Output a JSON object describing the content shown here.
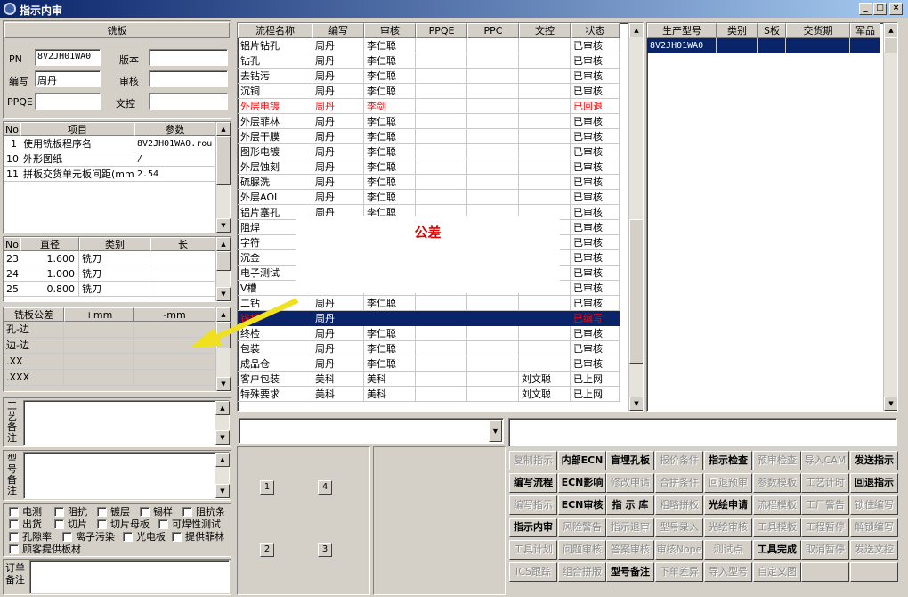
{
  "window": {
    "title": "指示内审"
  },
  "left": {
    "section_title": "铣板",
    "pn_label": "PN",
    "pn_value": "8V2JH01WA0",
    "version_label": "版本",
    "version_value": "",
    "writer_label": "编写",
    "writer_value": "周丹",
    "review_label": "审核",
    "review_value": "",
    "ppqe_label": "PPQE",
    "ppqe_value": "",
    "dc_label": "文控",
    "dc_value": "",
    "params": {
      "headers": [
        "No",
        "项目",
        "参数"
      ],
      "rows": [
        [
          "1",
          "使用铣板程序名",
          "8V2JH01WA0.rou"
        ],
        [
          "10",
          "外形图纸",
          "/"
        ],
        [
          "11",
          "拼板交货单元板间距(mm",
          "2.54"
        ]
      ]
    },
    "tools": {
      "headers": [
        "No",
        "直径",
        "类别",
        "长"
      ],
      "rows": [
        [
          "23",
          "1.600",
          "铣刀",
          ""
        ],
        [
          "24",
          "1.000",
          "铣刀",
          ""
        ],
        [
          "25",
          "0.800",
          "铣刀",
          ""
        ]
      ]
    },
    "tolerance": {
      "headers": [
        "铣板公差",
        "+mm",
        "-mm"
      ],
      "rows": [
        [
          "孔-边",
          "",
          ""
        ],
        [
          "边-边",
          "",
          ""
        ],
        [
          ".XX",
          "",
          ""
        ],
        [
          ".XXX",
          "",
          ""
        ]
      ]
    },
    "process_note_label": "工艺备注",
    "model_note_label": "型号备注",
    "order_note_label": "订单备注",
    "checkboxes": [
      {
        "label": "电测",
        "checked": false
      },
      {
        "label": "阻抗",
        "checked": false
      },
      {
        "label": "镀层",
        "checked": false
      },
      {
        "label": "锡样",
        "checked": false
      },
      {
        "label": "阻抗条",
        "checked": false
      },
      {
        "label": "出货",
        "checked": false
      },
      {
        "label": "切片",
        "checked": false
      },
      {
        "label": "切片母板",
        "checked": false
      },
      {
        "label": "可焊性测试",
        "checked": false
      },
      {
        "label": "孔隙率",
        "checked": false
      },
      {
        "label": "离子污染",
        "checked": false
      },
      {
        "label": "光电板",
        "checked": false
      },
      {
        "label": "提供菲林",
        "checked": false
      },
      {
        "label": "顾客提供板材",
        "checked": false
      }
    ]
  },
  "flow": {
    "headers": [
      "流程名称",
      "编写",
      "审核",
      "PPQE",
      "PPC",
      "文控",
      "状态"
    ],
    "rows": [
      {
        "c": [
          "铝片钻孔",
          "周丹",
          "李仁聪",
          "",
          "",
          "",
          "已审核"
        ],
        "s": "n"
      },
      {
        "c": [
          "钻孔",
          "周丹",
          "李仁聪",
          "",
          "",
          "",
          "已审核"
        ],
        "s": "n"
      },
      {
        "c": [
          "去钻污",
          "周丹",
          "李仁聪",
          "",
          "",
          "",
          "已审核"
        ],
        "s": "n"
      },
      {
        "c": [
          "沉铜",
          "周丹",
          "李仁聪",
          "",
          "",
          "",
          "已审核"
        ],
        "s": "n"
      },
      {
        "c": [
          "外层电镀",
          "周丹",
          "李剑",
          "",
          "",
          "",
          "已回退"
        ],
        "s": "r"
      },
      {
        "c": [
          "外层菲林",
          "周丹",
          "李仁聪",
          "",
          "",
          "",
          "已审核"
        ],
        "s": "n"
      },
      {
        "c": [
          "外层干膜",
          "周丹",
          "李仁聪",
          "",
          "",
          "",
          "已审核"
        ],
        "s": "n"
      },
      {
        "c": [
          "图形电镀",
          "周丹",
          "李仁聪",
          "",
          "",
          "",
          "已审核"
        ],
        "s": "n"
      },
      {
        "c": [
          "外层蚀刻",
          "周丹",
          "李仁聪",
          "",
          "",
          "",
          "已审核"
        ],
        "s": "n"
      },
      {
        "c": [
          "硫脲洗",
          "周丹",
          "李仁聪",
          "",
          "",
          "",
          "已审核"
        ],
        "s": "n"
      },
      {
        "c": [
          "外层AOI",
          "周丹",
          "李仁聪",
          "",
          "",
          "",
          "已审核"
        ],
        "s": "n"
      },
      {
        "c": [
          "铝片塞孔",
          "周丹",
          "李仁聪",
          "",
          "",
          "",
          "已审核"
        ],
        "s": "n"
      },
      {
        "c": [
          "阻焊",
          "",
          "",
          "",
          "",
          "",
          "已审核"
        ],
        "s": "n"
      },
      {
        "c": [
          "字符",
          "",
          "",
          "",
          "",
          "",
          "已审核"
        ],
        "s": "n"
      },
      {
        "c": [
          "沉金",
          "",
          "",
          "",
          "",
          "",
          "已审核"
        ],
        "s": "n"
      },
      {
        "c": [
          "电子测试",
          "",
          "",
          "",
          "",
          "",
          "已审核"
        ],
        "s": "n"
      },
      {
        "c": [
          "V槽",
          "",
          "",
          "",
          "",
          "",
          "已审核"
        ],
        "s": "n"
      },
      {
        "c": [
          "二钻",
          "周丹",
          "李仁聪",
          "",
          "",
          "",
          "已审核"
        ],
        "s": "n"
      },
      {
        "c": [
          "铣板",
          "周丹",
          "",
          "",
          "",
          "",
          "已编写"
        ],
        "s": "sel"
      },
      {
        "c": [
          "终检",
          "周丹",
          "李仁聪",
          "",
          "",
          "",
          "已审核"
        ],
        "s": "n"
      },
      {
        "c": [
          "包装",
          "周丹",
          "李仁聪",
          "",
          "",
          "",
          "已审核"
        ],
        "s": "n"
      },
      {
        "c": [
          "成品仓",
          "周丹",
          "李仁聪",
          "",
          "",
          "",
          "已审核"
        ],
        "s": "n"
      },
      {
        "c": [
          "客户包装",
          "美科",
          "美科",
          "",
          "",
          "刘文聪",
          "已上网"
        ],
        "s": "n"
      },
      {
        "c": [
          "特殊要求",
          "美科",
          "美科",
          "",
          "",
          "刘文聪",
          "已上网"
        ],
        "s": "n"
      }
    ],
    "popup_text": "公差"
  },
  "model_list": {
    "headers": [
      "生产型号",
      "类别",
      "S板",
      "交货期",
      "军品"
    ],
    "rows": [
      [
        "8V2JH01WA0",
        "",
        "",
        "",
        ""
      ]
    ]
  },
  "number_buttons": [
    "1",
    "4",
    "2",
    "3"
  ],
  "action_buttons": [
    [
      {
        "t": "复制指示",
        "e": 0
      },
      {
        "t": "内部ECN",
        "e": 1
      },
      {
        "t": "盲埋孔板",
        "e": 1
      },
      {
        "t": "报价条件",
        "e": 0
      },
      {
        "t": "指示检查",
        "e": 1
      },
      {
        "t": "预审检查",
        "e": 0
      },
      {
        "t": "导入CAM",
        "e": 0
      },
      {
        "t": "发送指示",
        "e": 1
      }
    ],
    [
      {
        "t": "编写流程",
        "e": 1
      },
      {
        "t": "ECN影响",
        "e": 1
      },
      {
        "t": "修改申请",
        "e": 0
      },
      {
        "t": "合拼条件",
        "e": 0
      },
      {
        "t": "回退预审",
        "e": 0
      },
      {
        "t": "参数模板",
        "e": 0
      },
      {
        "t": "工艺计时",
        "e": 0
      },
      {
        "t": "回退指示",
        "e": 1
      }
    ],
    [
      {
        "t": "编写指示",
        "e": 0
      },
      {
        "t": "ECN审核",
        "e": 1
      },
      {
        "t": "指 示 库",
        "e": 1
      },
      {
        "t": "粗略拼板",
        "e": 0
      },
      {
        "t": "光绘申请",
        "e": 1
      },
      {
        "t": "流程模板",
        "e": 0
      },
      {
        "t": "工厂警告",
        "e": 0
      },
      {
        "t": "锁住编写",
        "e": 0
      }
    ],
    [
      {
        "t": "指示内审",
        "e": 1
      },
      {
        "t": "风险警告",
        "e": 0
      },
      {
        "t": "指示退审",
        "e": 0
      },
      {
        "t": "型号录入",
        "e": 0
      },
      {
        "t": "光绘审核",
        "e": 0
      },
      {
        "t": "工具模板",
        "e": 0
      },
      {
        "t": "工程暂停",
        "e": 0
      },
      {
        "t": "解锁编写",
        "e": 0
      }
    ],
    [
      {
        "t": "工具计划",
        "e": 0
      },
      {
        "t": "问题审核",
        "e": 0
      },
      {
        "t": "答案审核",
        "e": 0
      },
      {
        "t": "审核Nope",
        "e": 0
      },
      {
        "t": "测试点",
        "e": 0
      },
      {
        "t": "工具完成",
        "e": 1
      },
      {
        "t": "取消暂停",
        "e": 0
      },
      {
        "t": "发送文控",
        "e": 0
      }
    ],
    [
      {
        "t": "ICS跟踪",
        "e": 0
      },
      {
        "t": "组合拼版",
        "e": 0
      },
      {
        "t": "型号备注",
        "e": 1
      },
      {
        "t": "下单差异",
        "e": 0
      },
      {
        "t": "导入型号",
        "e": 0
      },
      {
        "t": "自定义图",
        "e": 0
      },
      {
        "t": "",
        "e": 0
      },
      {
        "t": "",
        "e": 0
      }
    ]
  ],
  "colors": {
    "titlebar": "#0a246a",
    "selection": "#0a246a",
    "returned": "#ff0000",
    "arrow": "#f0e020"
  }
}
